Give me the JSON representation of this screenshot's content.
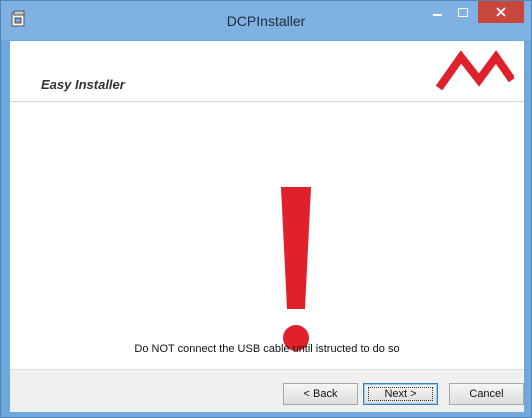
{
  "window": {
    "title": "DCPInstaller",
    "icon": "installer-icon",
    "controls": {
      "minimize": "minimize-icon",
      "maximize": "maximize-icon",
      "close": "close-icon"
    }
  },
  "header": {
    "title": "Easy Installer",
    "logo": "brand-logo"
  },
  "content": {
    "icon": "exclamation-warning-icon",
    "message": "Do NOT connect the USB cable until istructed to do so"
  },
  "buttons": {
    "back": "< Back",
    "next": "Next >",
    "cancel": "Cancel"
  },
  "colors": {
    "accent_red": "#e0202a",
    "titlebar": "#7fb2e3",
    "close_button": "#c9463d"
  }
}
